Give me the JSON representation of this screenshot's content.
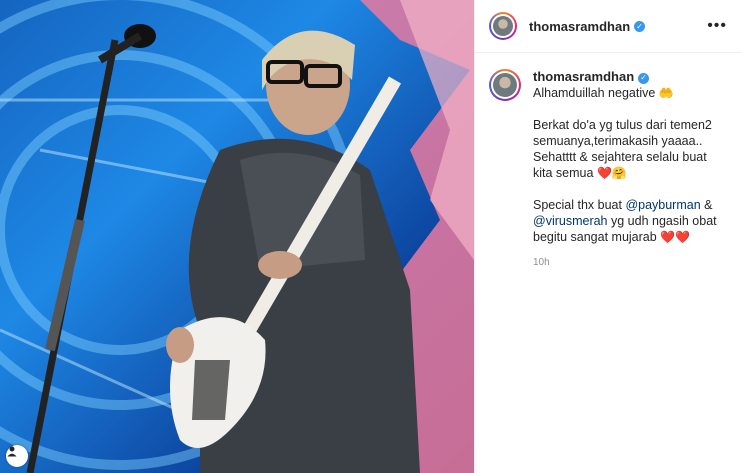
{
  "post": {
    "username": "thomasramdhan",
    "verified_icon": "verified-badge-icon",
    "more_icon": "more-options-icon"
  },
  "caption": {
    "username": "thomasramdhan",
    "line1": "Alhamduillah negative",
    "line1_emoji": "🤲",
    "para2": "Berkat do'a yg tulus dari temen2 semuanya,terimakasih yaaaa.. Sehatttt & sejahtera selalu buat kita semua",
    "para2_emoji": "❤️🤗",
    "para3_pre": "Special thx buat",
    "mention1": "@payburman",
    "para3_mid": "&",
    "mention2": "@virusmerah",
    "para3_post": "yg udh ngasih obat begitu sangat mujarab",
    "para3_emoji": "❤️❤️",
    "time": "10h"
  },
  "colors": {
    "accent_link": "#00376b",
    "verified": "#3897f0",
    "heart": "#e0245e"
  }
}
